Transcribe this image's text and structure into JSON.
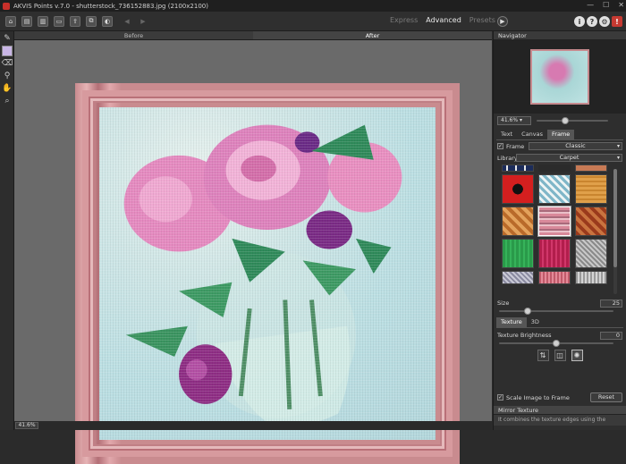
{
  "window": {
    "title": "AKVIS Points v.7.0 - shutterstock_736152883.jpg (2100x2100)",
    "controls": [
      "—",
      "☐",
      "✕"
    ]
  },
  "toolbar": {
    "modes": [
      {
        "label": "Express",
        "active": false
      },
      {
        "label": "Advanced",
        "active": true
      },
      {
        "label": "Presets",
        "active": false
      }
    ],
    "right_icons": {
      "info": "i",
      "help": "?",
      "settings": "⚙",
      "alert": "!"
    }
  },
  "view_tabs": {
    "before": "Before",
    "after": "After"
  },
  "status": {
    "zoom": "41.6%"
  },
  "navigator": {
    "title": "Navigator",
    "zoom": "41.6%"
  },
  "settings_tabs": [
    {
      "label": "Text",
      "active": false
    },
    {
      "label": "Canvas",
      "active": false
    },
    {
      "label": "Frame",
      "active": true
    }
  ],
  "frame": {
    "enabled_label": "Frame",
    "enabled": true,
    "style": "Classic",
    "library_label": "Library",
    "library": "Carpet",
    "size_label": "Size",
    "size_value": "25",
    "size_fraction": 0.25
  },
  "texture_tabs": [
    {
      "label": "Texture",
      "active": true
    },
    {
      "label": "3D",
      "active": false
    }
  ],
  "texture": {
    "brightness_label": "Texture Brightness",
    "brightness_value": "0",
    "brightness_fraction": 0.5,
    "scale_label": "Scale Image to Frame",
    "scale_checked": true,
    "reset_label": "Reset"
  },
  "help": {
    "title": "Mirror Texture",
    "text": "It combines the texture edges using the"
  },
  "colors": {
    "accent_active_tab": "#565656",
    "frame_pink": "#d79a9e",
    "alert_red": "#c63a32"
  }
}
